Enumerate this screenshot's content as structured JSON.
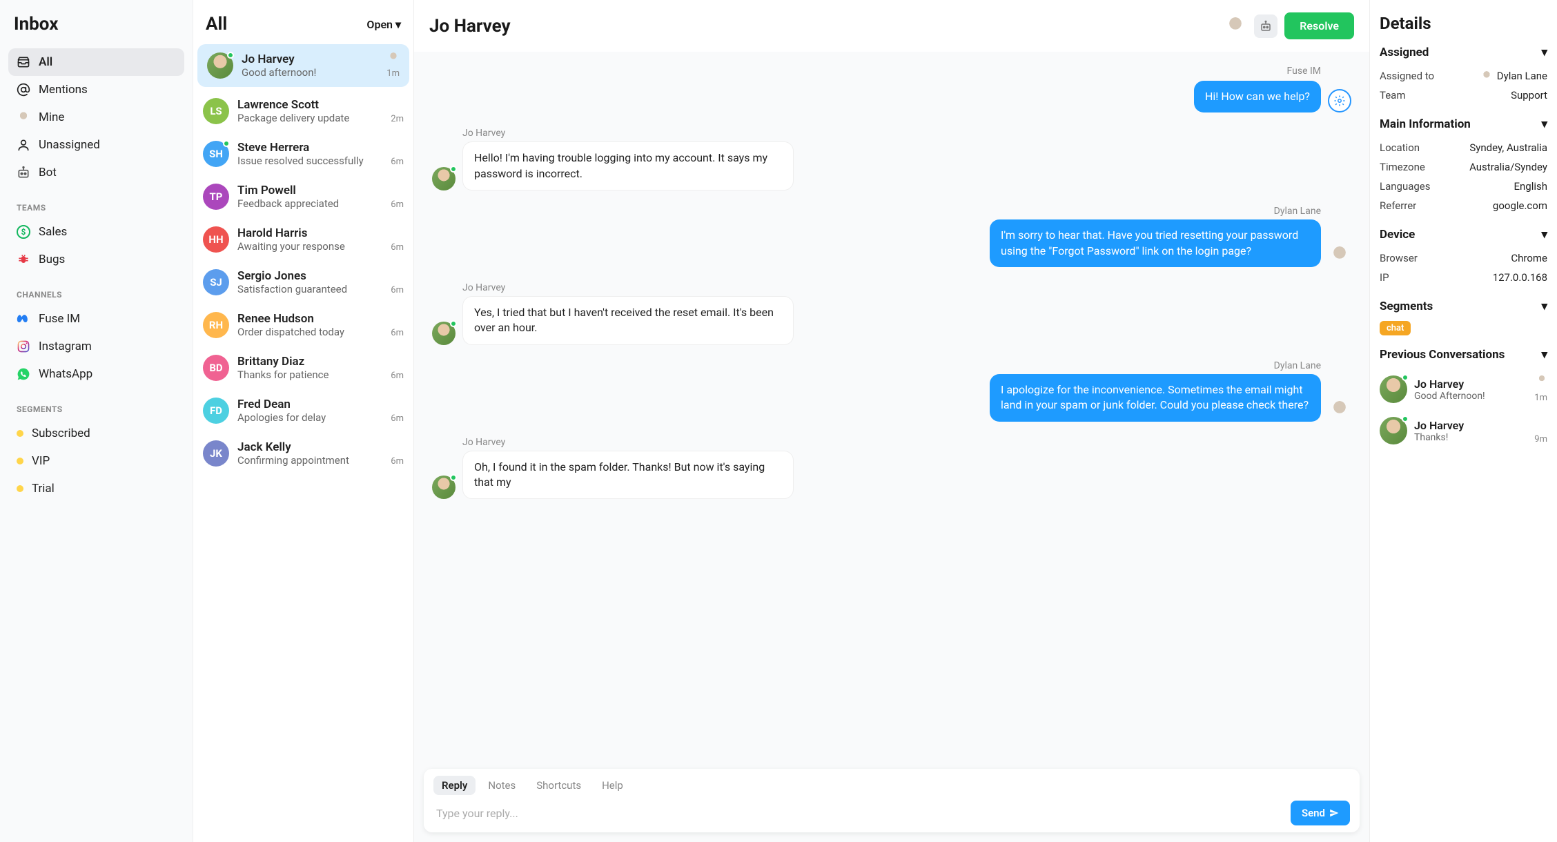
{
  "sidebar": {
    "title": "Inbox",
    "nav": [
      {
        "label": "All",
        "icon": "tray"
      },
      {
        "label": "Mentions",
        "icon": "at"
      },
      {
        "label": "Mine",
        "icon": "avatar"
      },
      {
        "label": "Unassigned",
        "icon": "user"
      },
      {
        "label": "Bot",
        "icon": "robot"
      }
    ],
    "teams_label": "TEAMS",
    "teams": [
      {
        "label": "Sales",
        "icon": "dollar"
      },
      {
        "label": "Bugs",
        "icon": "bug"
      }
    ],
    "channels_label": "CHANNELS",
    "channels": [
      {
        "label": "Fuse IM",
        "icon": "meta"
      },
      {
        "label": "Instagram",
        "icon": "instagram"
      },
      {
        "label": "WhatsApp",
        "icon": "whatsapp"
      }
    ],
    "segments_label": "SEGMENTS",
    "segments": [
      {
        "label": "Subscribed"
      },
      {
        "label": "VIP"
      },
      {
        "label": "Trial"
      }
    ]
  },
  "conv_header": {
    "title": "All",
    "filter": "Open"
  },
  "conversations": [
    {
      "name": "Jo Harvey",
      "preview": "Good afternoon!",
      "time": "1m",
      "initials": "",
      "photo": true,
      "online": true,
      "active": true,
      "assignee": true,
      "color": "#7ba85c"
    },
    {
      "name": "Lawrence Scott",
      "preview": "Package delivery update",
      "time": "2m",
      "initials": "LS",
      "color": "#8bc34a"
    },
    {
      "name": "Steve Herrera",
      "preview": "Issue resolved successfully",
      "time": "6m",
      "initials": "SH",
      "color": "#42a5f5",
      "online": true
    },
    {
      "name": "Tim Powell",
      "preview": "Feedback appreciated",
      "time": "6m",
      "initials": "TP",
      "color": "#ab47bc"
    },
    {
      "name": "Harold Harris",
      "preview": "Awaiting your response",
      "time": "6m",
      "initials": "HH",
      "color": "#ef5350"
    },
    {
      "name": "Sergio Jones",
      "preview": "Satisfaction guaranteed",
      "time": "6m",
      "initials": "SJ",
      "color": "#5c9ded"
    },
    {
      "name": "Renee Hudson",
      "preview": "Order dispatched today",
      "time": "6m",
      "initials": "RH",
      "color": "#ffb74d"
    },
    {
      "name": "Brittany Diaz",
      "preview": "Thanks for patience",
      "time": "6m",
      "initials": "BD",
      "color": "#f06292"
    },
    {
      "name": "Fred Dean",
      "preview": "Apologies for delay",
      "time": "6m",
      "initials": "FD",
      "color": "#4dd0e1"
    },
    {
      "name": "Jack Kelly",
      "preview": "Confirming appointment",
      "time": "6m",
      "initials": "JK",
      "color": "#7986cb"
    }
  ],
  "chat": {
    "title": "Jo Harvey",
    "resolve_label": "Resolve",
    "via": "Fuse IM",
    "messages": [
      {
        "dir": "out",
        "sender": "",
        "text": "Hi! How can we help?",
        "avatar": "gear"
      },
      {
        "dir": "in",
        "sender": "Jo Harvey",
        "text": "Hello! I'm having trouble logging into my account. It says my password is incorrect."
      },
      {
        "dir": "out",
        "sender": "Dylan Lane",
        "text": "I'm sorry to hear that. Have you tried resetting your password using the \"Forgot Password\" link on the login page?"
      },
      {
        "dir": "in",
        "sender": "Jo Harvey",
        "text": "Yes, I tried that but I haven't received the reset email. It's been over an hour."
      },
      {
        "dir": "out",
        "sender": "Dylan Lane",
        "text": "I apologize for the inconvenience. Sometimes the email might land in your spam or junk folder. Could you please check there?"
      },
      {
        "dir": "in",
        "sender": "Jo Harvey",
        "text": "Oh, I found it in the spam folder. Thanks! But now it's saying that my"
      }
    ],
    "composer": {
      "tabs": [
        "Reply",
        "Notes",
        "Shortcuts",
        "Help"
      ],
      "placeholder": "Type your reply...",
      "send_label": "Send"
    }
  },
  "details": {
    "title": "Details",
    "assigned": {
      "label": "Assigned",
      "rows": [
        {
          "k": "Assigned to",
          "v": "Dylan Lane",
          "avatar": true
        },
        {
          "k": "Team",
          "v": "Support"
        }
      ]
    },
    "main": {
      "label": "Main Information",
      "rows": [
        {
          "k": "Location",
          "v": "Syndey, Australia"
        },
        {
          "k": "Timezone",
          "v": "Australia/Syndey"
        },
        {
          "k": "Languages",
          "v": "English"
        },
        {
          "k": "Referrer",
          "v": "google.com"
        }
      ]
    },
    "device": {
      "label": "Device",
      "rows": [
        {
          "k": "Browser",
          "v": "Chrome"
        },
        {
          "k": "IP",
          "v": "127.0.0.168"
        }
      ]
    },
    "segments": {
      "label": "Segments",
      "chips": [
        "chat"
      ]
    },
    "prev": {
      "label": "Previous Conversations",
      "items": [
        {
          "name": "Jo Harvey",
          "msg": "Good Afternoon!",
          "time": "1m",
          "assignee": true
        },
        {
          "name": "Jo Harvey",
          "msg": "Thanks!",
          "time": "9m"
        }
      ]
    }
  }
}
